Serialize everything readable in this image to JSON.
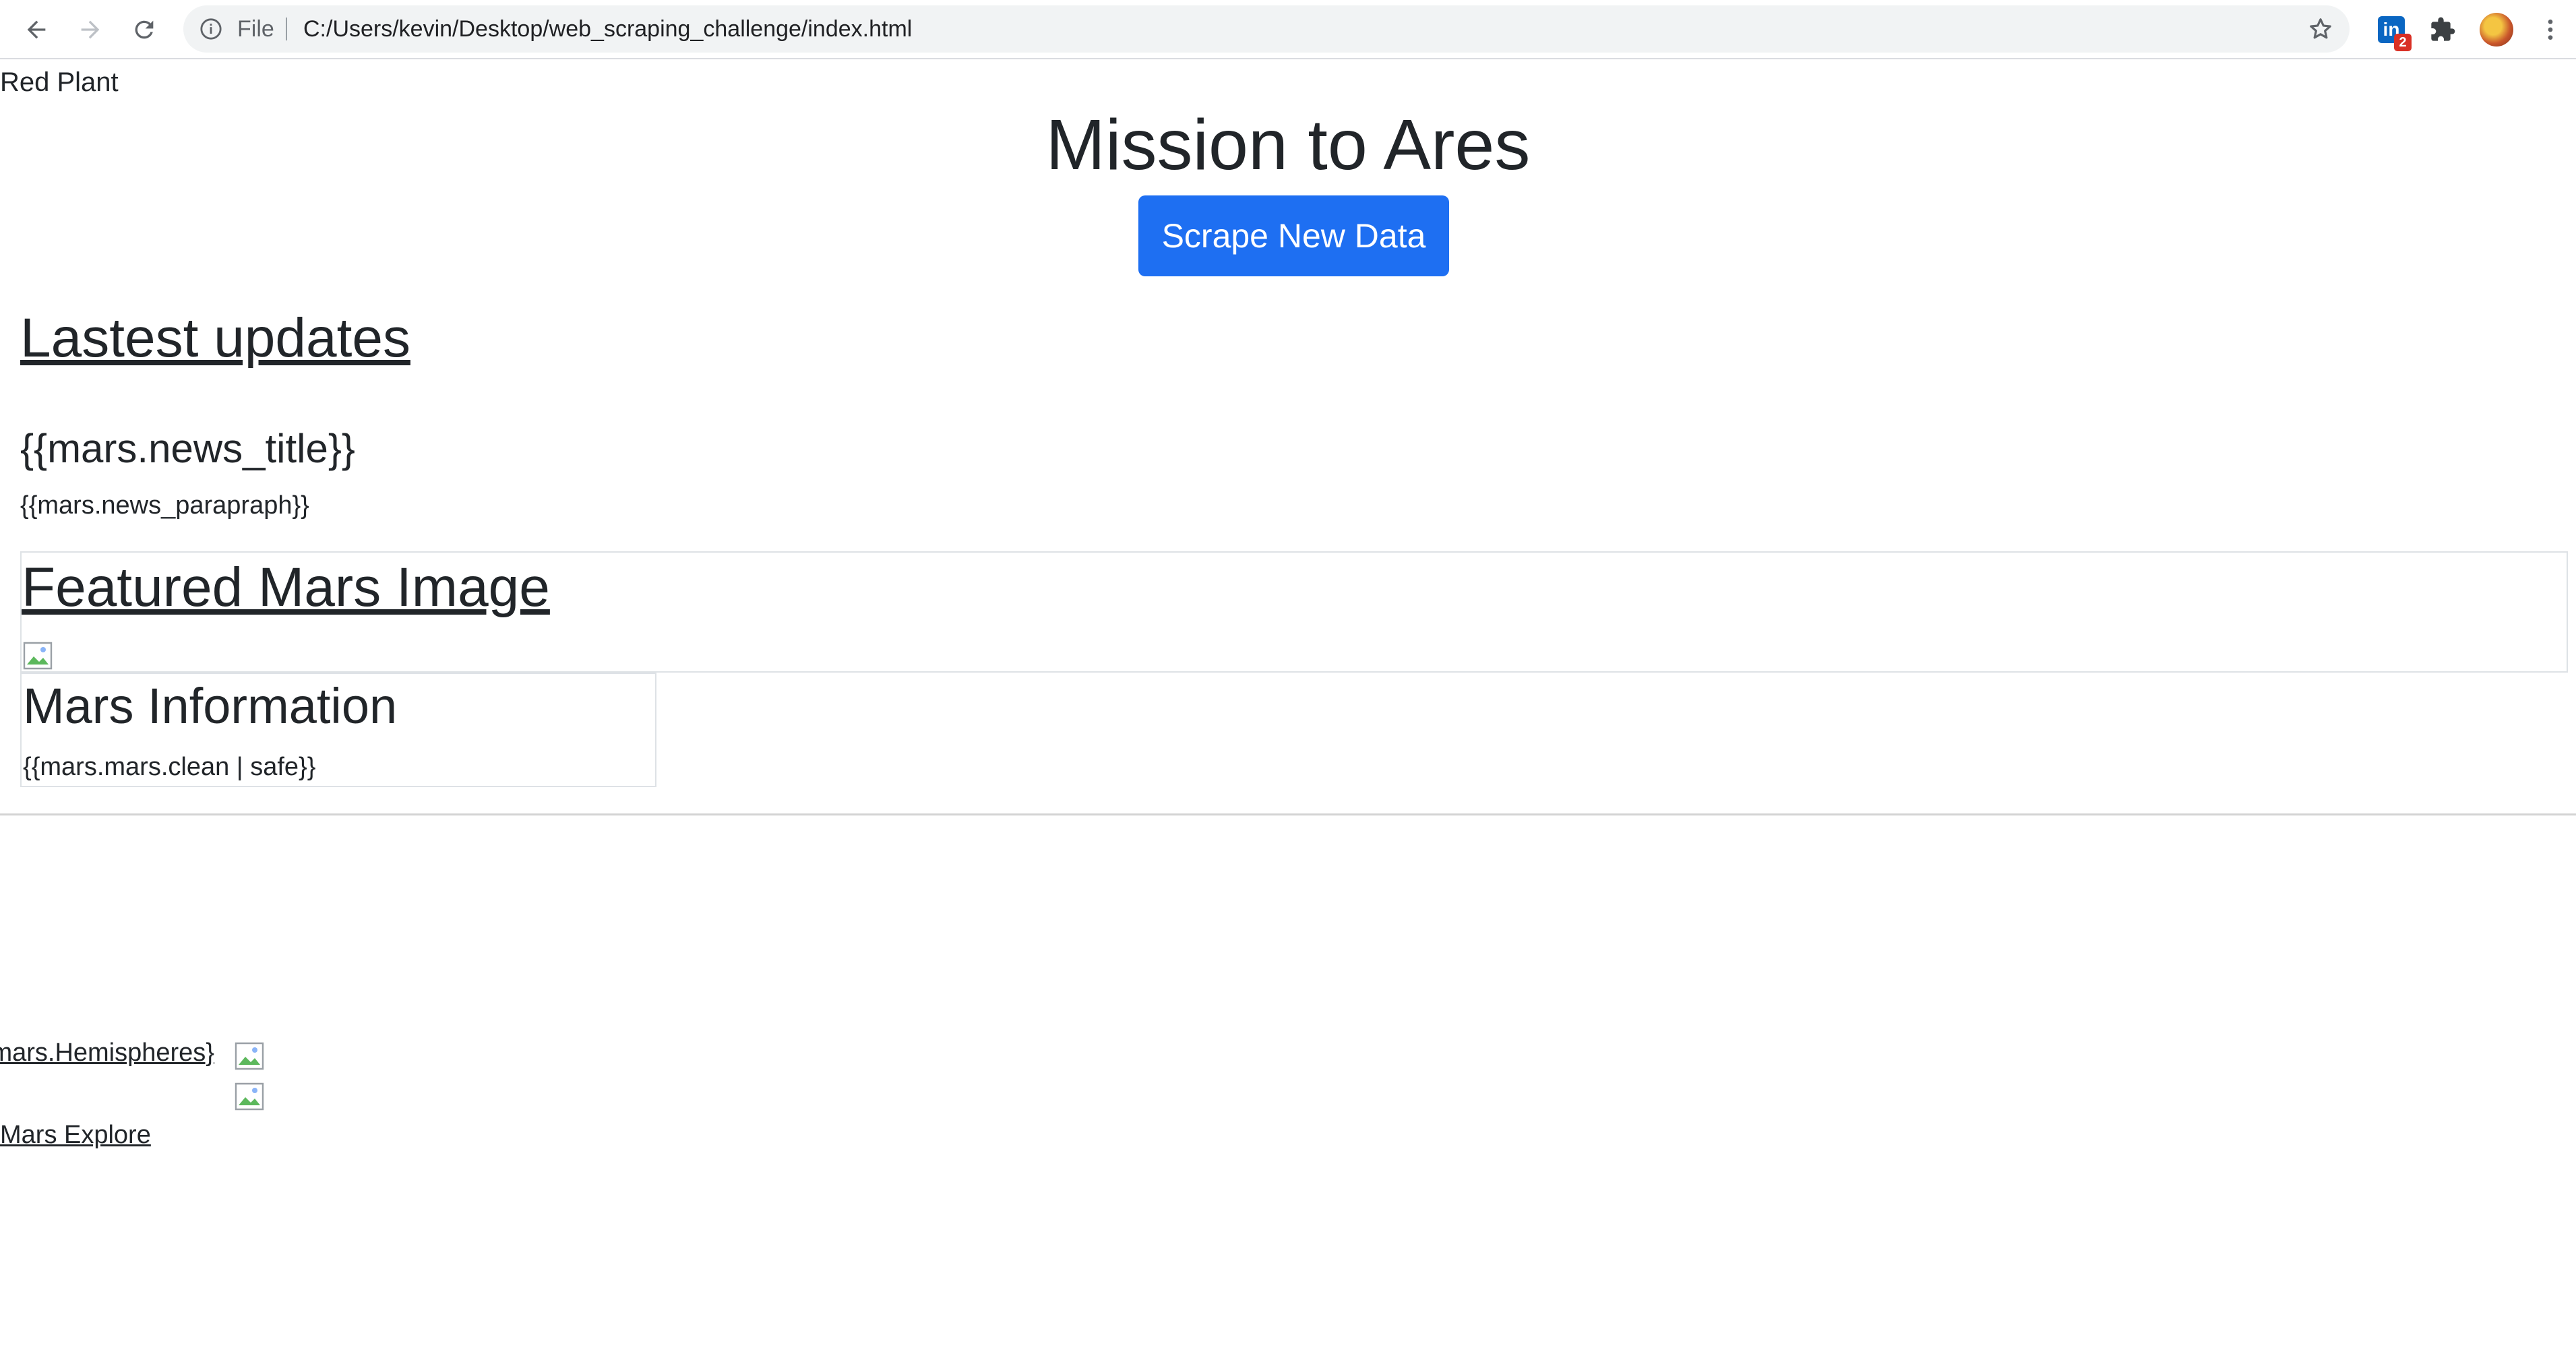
{
  "browser": {
    "file_label": "File",
    "url": "C:/Users/kevin/Desktop/web_scraping_challenge/index.html",
    "extension_badge": "2",
    "extension_letters": "in"
  },
  "page": {
    "brand": "Red Plant",
    "title": "Mission to Ares",
    "scrape_button": "Scrape New Data",
    "latest_heading": "Lastest updates",
    "news_title": "{{mars.news_title}}",
    "news_paragraph": "{{mars.news_parapraph}}",
    "featured_heading": "Featured Mars Image",
    "info_heading": "Mars Information",
    "info_text": "{{mars.mars.clean | safe}}",
    "hemispheres_link": "mars.Hemispheres}",
    "explore_link": "Mars Explore"
  },
  "colors": {
    "button_primary": "#1e6ff2",
    "text": "#212529",
    "border": "#dee2e6"
  }
}
